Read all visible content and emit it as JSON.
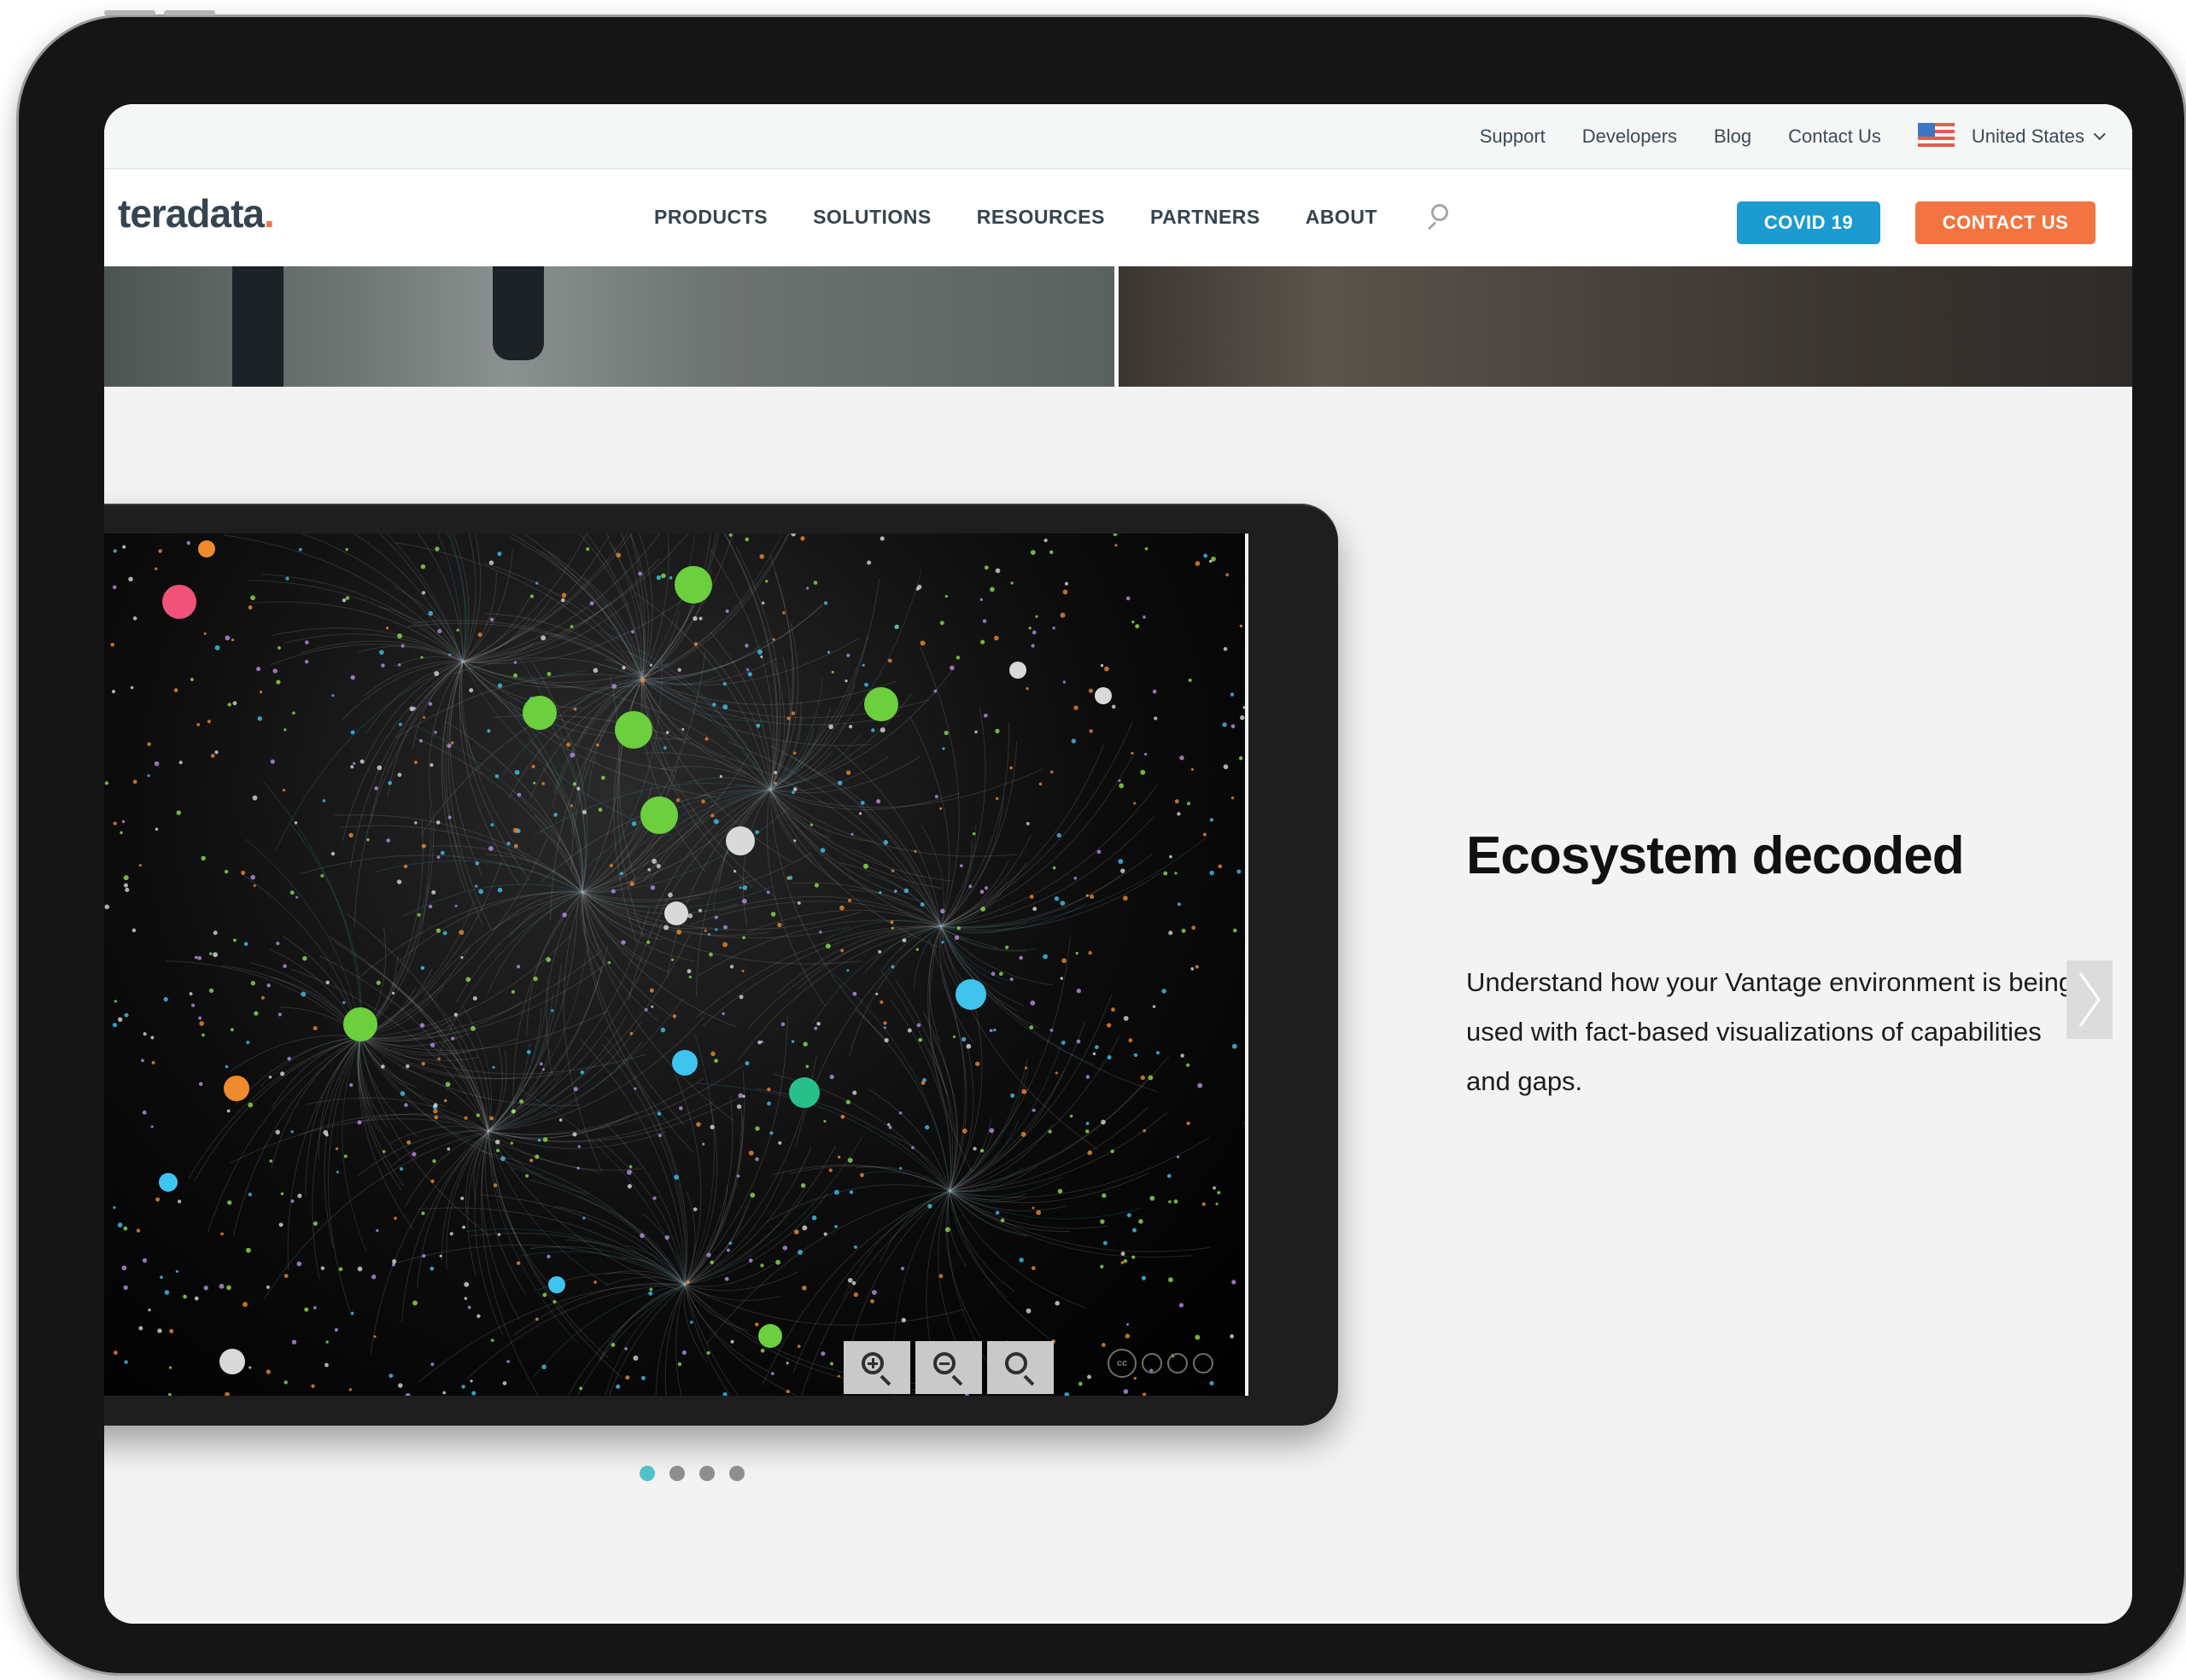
{
  "utility_nav": {
    "links": [
      "Support",
      "Developers",
      "Blog",
      "Contact Us"
    ],
    "country": "United States"
  },
  "header": {
    "logo_text": "teradata",
    "logo_dot": ".",
    "nav": [
      "PRODUCTS",
      "SOLUTIONS",
      "RESOURCES",
      "PARTNERS",
      "ABOUT"
    ],
    "buttons": {
      "covid": "COVID 19",
      "contact": "CONTACT US"
    }
  },
  "slide": {
    "title": "Ecosystem decoded",
    "body": "Understand how your Vantage environment is being used with fact-based visualizations of capabilities and gaps."
  },
  "visualization": {
    "zoom_controls": [
      "zoom-in",
      "zoom-out",
      "reset-zoom"
    ],
    "license_icons": [
      "cc",
      "by",
      "nc",
      "sa"
    ]
  },
  "carousel": {
    "total_slides": 4,
    "active_index": 0
  },
  "colors": {
    "brand_dark": "#35444e",
    "brand_orange": "#f37440",
    "covid_blue": "#1b9bd0",
    "dot_active": "#4fc1c9",
    "dot_inactive": "#8e8e8e"
  }
}
